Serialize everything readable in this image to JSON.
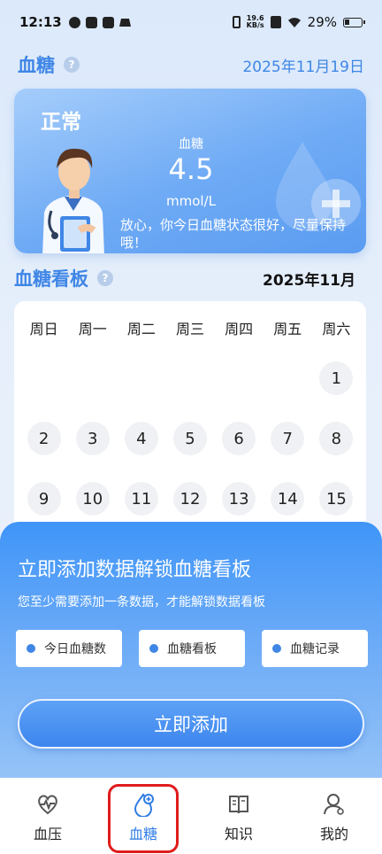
{
  "status_bar": {
    "time": "12:13",
    "network_speed_value": "19.6",
    "network_speed_unit": "KB/s",
    "battery": "29%"
  },
  "header": {
    "title": "血糖",
    "date": "2025年11月19日"
  },
  "status_card": {
    "level": "正常",
    "metric_label": "血糖",
    "value": "4.5",
    "unit": "mmol/L",
    "message": "放心，你今日血糖状态很好，尽量保持哦！"
  },
  "board": {
    "title": "血糖看板",
    "month": "2025年11月",
    "weekdays": [
      "周日",
      "周一",
      "周二",
      "周三",
      "周四",
      "周五",
      "周六"
    ],
    "days": [
      "",
      "",
      "",
      "",
      "",
      "",
      "1",
      "2",
      "3",
      "4",
      "5",
      "6",
      "7",
      "8",
      "9",
      "10",
      "11",
      "12",
      "13",
      "14",
      "15"
    ]
  },
  "unlock_panel": {
    "title": "立即添加数据解锁血糖看板",
    "subtitle": "您至少需要添加一条数据，才能解锁数据看板",
    "features": [
      "今日血糖数",
      "血糖看板",
      "血糖记录"
    ],
    "button_label": "立即添加"
  },
  "bottom_nav": {
    "items": [
      {
        "label": "血压",
        "icon": "heart-pulse-icon"
      },
      {
        "label": "血糖",
        "icon": "blood-drop-plus-icon",
        "active": true
      },
      {
        "label": "知识",
        "icon": "book-icon"
      },
      {
        "label": "我的",
        "icon": "profile-icon"
      }
    ]
  },
  "colors": {
    "accent": "#3f86e6",
    "highlight": "#e01b1b"
  }
}
